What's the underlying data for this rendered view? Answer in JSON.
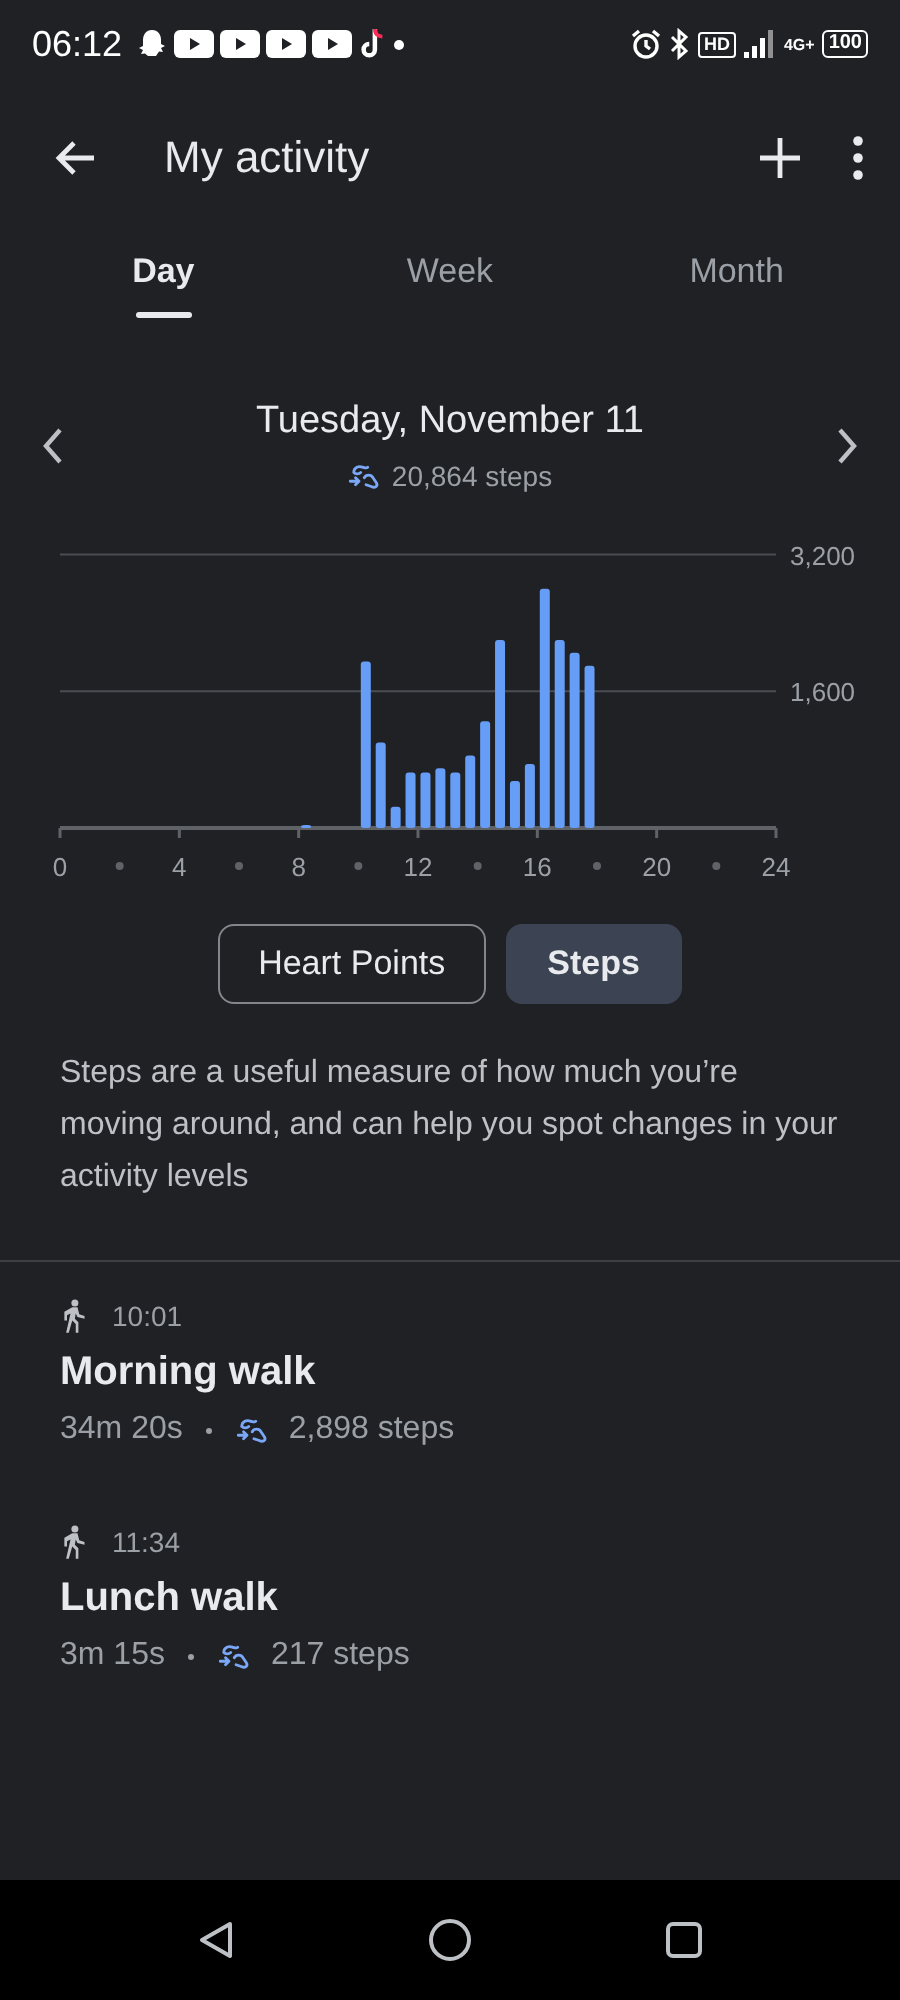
{
  "status_bar": {
    "time": "06:12",
    "hd": "HD",
    "network": "4G+",
    "battery": "100"
  },
  "app_bar": {
    "title": "My activity"
  },
  "tabs": [
    {
      "label": "Day",
      "selected": true
    },
    {
      "label": "Week",
      "selected": false
    },
    {
      "label": "Month",
      "selected": false
    }
  ],
  "date_header": {
    "date": "Tuesday, November 11",
    "steps": "20,864 steps"
  },
  "chart_data": {
    "type": "bar",
    "x": [
      8.25,
      10.25,
      10.75,
      11.25,
      11.75,
      12.25,
      12.75,
      13.25,
      13.75,
      14.25,
      14.75,
      15.25,
      15.75,
      16.25,
      16.75,
      17.25,
      17.75
    ],
    "values": [
      20,
      1950,
      1000,
      250,
      650,
      650,
      700,
      650,
      850,
      1250,
      2200,
      550,
      750,
      2800,
      2200,
      2050,
      1900
    ],
    "xlim": [
      0,
      24
    ],
    "ylim": [
      0,
      3200
    ],
    "xticks": [
      0,
      4,
      8,
      12,
      16,
      20,
      24
    ],
    "yticks": [
      {
        "value": 1600,
        "label": "1,600"
      },
      {
        "value": 3200,
        "label": "3,200"
      }
    ]
  },
  "metric_toggle": [
    {
      "label": "Heart Points",
      "selected": false
    },
    {
      "label": "Steps",
      "selected": true
    }
  ],
  "description": "Steps are a useful measure of how much you’re moving around, and can help you spot changes in your activity levels",
  "activities": [
    {
      "time": "10:01",
      "title": "Morning walk",
      "duration": "34m 20s",
      "steps": "2,898 steps"
    },
    {
      "time": "11:34",
      "title": "Lunch walk",
      "duration": "3m 15s",
      "steps": "217 steps"
    }
  ]
}
